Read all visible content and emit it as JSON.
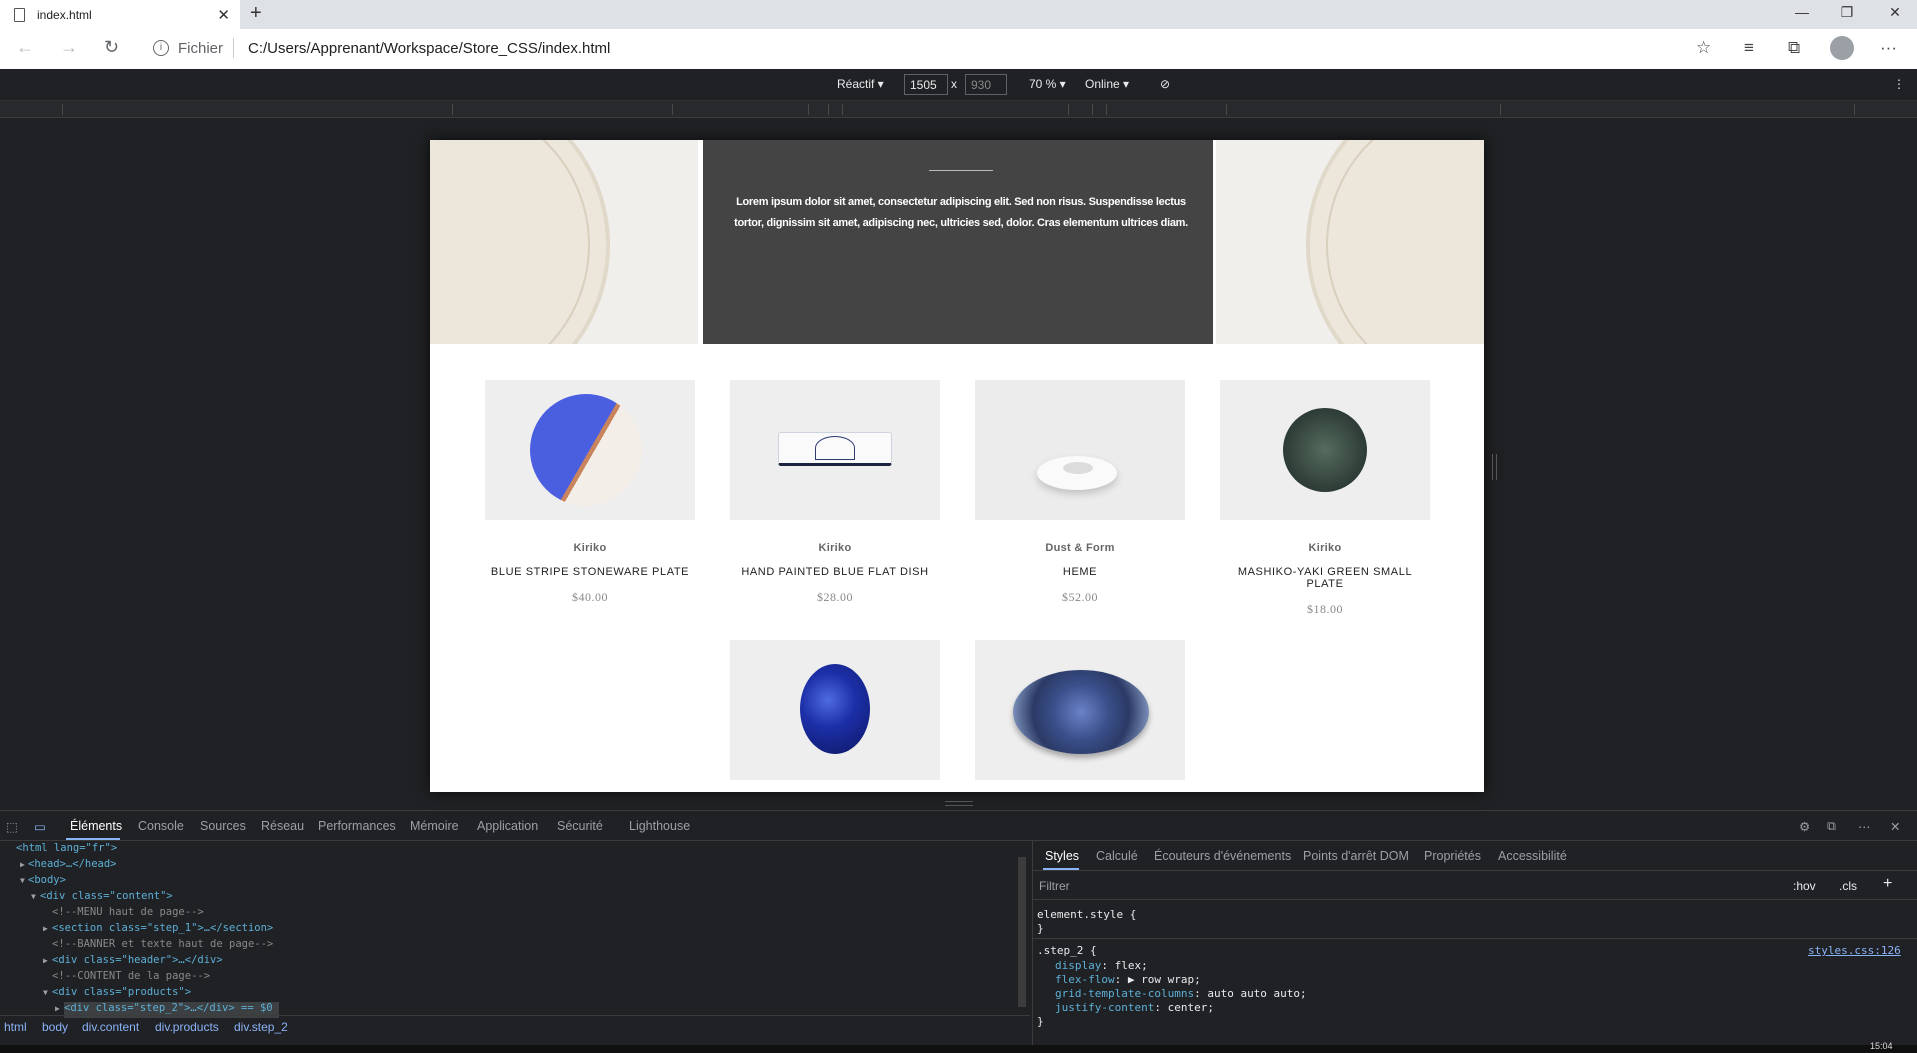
{
  "browser": {
    "tab_title": "index.html",
    "url_scheme": "Fichier",
    "url_path": "C:/Users/Apprenant/Workspace/Store_CSS/index.html"
  },
  "device_toolbar": {
    "mode": "Réactif ▾",
    "width": "1505",
    "height": "930",
    "times": "x",
    "zoom": "70 % ▾",
    "network": "Online ▾"
  },
  "banner": {
    "text": "Lorem ipsum dolor sit amet, consectetur adipiscing elit. Sed non risus. Suspendisse lectus tortor, dignissim sit amet, adipiscing nec, ultricies sed, dolor. Cras elementum ultrices diam."
  },
  "products": [
    {
      "brand": "Kiriko",
      "name": "BLUE STRIPE STONEWARE PLATE",
      "price": "$40.00"
    },
    {
      "brand": "Kiriko",
      "name": "HAND PAINTED BLUE FLAT DISH",
      "price": "$28.00"
    },
    {
      "brand": "Dust & Form",
      "name": "HEME",
      "price": "$52.00"
    },
    {
      "brand": "Kiriko",
      "name": "MASHIKO-YAKI GREEN SMALL PLATE",
      "price": "$18.00"
    }
  ],
  "devtools": {
    "tabs": [
      "Éléments",
      "Console",
      "Sources",
      "Réseau",
      "Performances",
      "Mémoire",
      "Application",
      "Sécurité",
      "Lighthouse"
    ],
    "styles_tabs": [
      "Styles",
      "Calculé",
      "Écouteurs d'événements",
      "Points d'arrêt DOM",
      "Propriétés",
      "Accessibilité"
    ],
    "filter_placeholder": "Filtrer",
    "hov": ":hov",
    "cls": ".cls",
    "breadcrumbs": [
      "html",
      "body",
      "div.content",
      "div.products",
      "div.step_2"
    ],
    "style_source": "styles.css:126",
    "selector": ".step_2 {",
    "element_style": "element.style {",
    "close_brace": "}",
    "rules": [
      {
        "prop": "display",
        "value": "flex;"
      },
      {
        "prop": "flex-flow",
        "value": "▶ row wrap;"
      },
      {
        "prop": "grid-template-columns",
        "value": "auto auto auto;"
      },
      {
        "prop": "justify-content",
        "value": "center;"
      }
    ],
    "dom": {
      "l1": "<html lang=\"fr\">",
      "l2": "<head>…</head>",
      "l3": "<body>",
      "l4": "<div class=\"content\">",
      "l5": "<!--MENU haut de page-->",
      "l6": "<section class=\"step_1\">…</section>",
      "l7": "<!--BANNER et texte haut de page-->",
      "l8": "<div class=\"header\">…</div>",
      "l9": "<!--CONTENT de la page-->",
      "l10": "<div class=\"products\">",
      "l11": "<div class=\"step_2\">…</div> == $0"
    }
  },
  "clock": "15:04"
}
